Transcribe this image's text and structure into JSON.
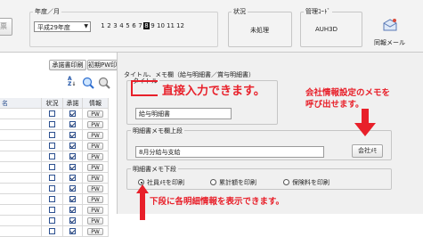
{
  "toolbar": {
    "left_button_partial": "票",
    "year_label": "年度／月",
    "year_value": "平成29年度",
    "months": [
      "1",
      "2",
      "3",
      "4",
      "5",
      "6",
      "7",
      "8",
      "9",
      "10",
      "11",
      "12"
    ],
    "selected_month": "8",
    "status_label": "状況",
    "status_value": "未処理",
    "mgmt_code_label": "管理ｺｰﾄﾞ",
    "mgmt_code_value": "AUH3D",
    "send_mail_label": "同報メール"
  },
  "left_pane": {
    "approve_print_button": "承諾書印刷",
    "first_pw_print_button": "初期PW印刷",
    "sort_icon_text": "A\nZ",
    "columns": [
      "名",
      "状況",
      "承諾",
      "情報"
    ],
    "rows": [
      {
        "status": false,
        "approve": true,
        "info": "PW"
      },
      {
        "status": false,
        "approve": true,
        "info": "PW"
      },
      {
        "status": false,
        "approve": true,
        "info": "PW"
      },
      {
        "status": false,
        "approve": true,
        "info": "PW"
      },
      {
        "status": false,
        "approve": true,
        "info": "PW"
      },
      {
        "status": false,
        "approve": true,
        "info": "PW"
      },
      {
        "status": false,
        "approve": true,
        "info": "PW"
      },
      {
        "status": false,
        "approve": true,
        "info": "PW"
      },
      {
        "status": false,
        "approve": true,
        "info": "PW"
      },
      {
        "status": false,
        "approve": true,
        "info": "PW"
      },
      {
        "status": false,
        "approve": true,
        "info": "PW"
      },
      {
        "status": false,
        "approve": true,
        "info": "PW"
      }
    ]
  },
  "right_pane": {
    "header": "タイトル、メモ欄（給与明細書／賞与明細書）",
    "title_label": "タイトル",
    "title_value": "給与明細書",
    "memo_upper_label": "明細書メモ欄上段",
    "memo_upper_value": "8月分給与支給",
    "company_memo_button": "会社ﾒﾓ",
    "memo_lower_label": "明細書メモ下段",
    "radio_options": [
      {
        "label": "社員ﾒﾓを印刷",
        "selected": true
      },
      {
        "label": "累計額を印刷",
        "selected": false
      },
      {
        "label": "保険料を印刷",
        "selected": false
      }
    ]
  },
  "annotations": {
    "direct_input": "直接入力できます。",
    "company_memo_line1": "会社情報設定のメモを",
    "company_memo_line2": "呼び出せます。",
    "lower_info": "下段に各明細情報を表示できます。"
  },
  "colors": {
    "annotation_red": "#e8202a",
    "checkbox_blue": "#2b4f8f"
  }
}
